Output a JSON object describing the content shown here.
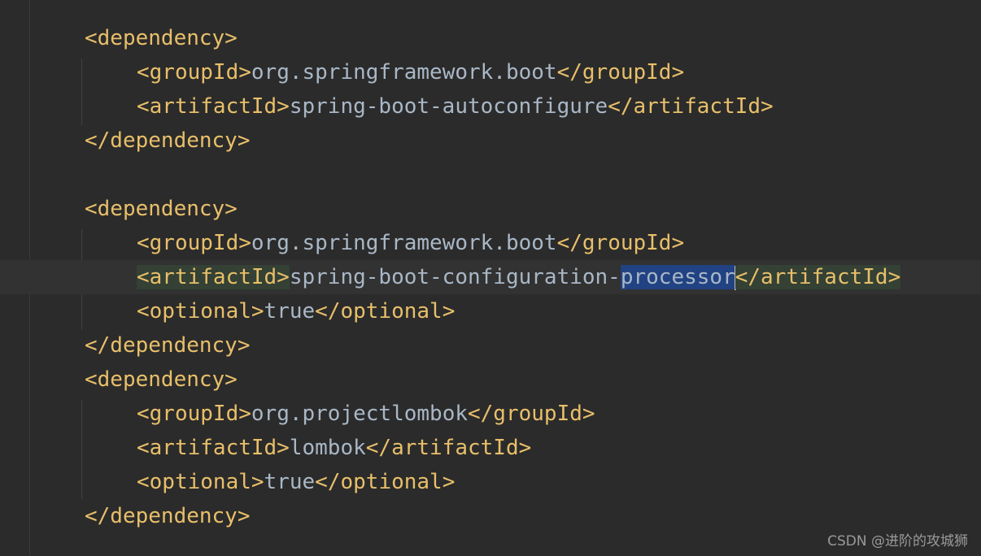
{
  "code": {
    "l1": [
      "<dependency>"
    ],
    "l2": [
      "<groupId>",
      "org.springframework.boot",
      "</groupId>"
    ],
    "l3": [
      "<artifactId>",
      "spring-boot-autoconfigure",
      "</artifactId>"
    ],
    "l4": [
      "</dependency>"
    ],
    "l6": [
      "<dependency>"
    ],
    "l7": [
      "<groupId>",
      "org.springframework.boot",
      "</groupId>"
    ],
    "l8": [
      "<artifactId>",
      "spring-boot-configuration-",
      "processor",
      "</artifactId>"
    ],
    "l9": [
      "<optional>",
      "true",
      "</optional>"
    ],
    "l10": [
      "</dependency>"
    ],
    "l11": [
      "<dependency>"
    ],
    "l12": [
      "<groupId>",
      "org.projectlombok",
      "</groupId>"
    ],
    "l13": [
      "<artifactId>",
      "lombok",
      "</artifactId>"
    ],
    "l14": [
      "<optional>",
      "true",
      "</optional>"
    ],
    "l15": [
      "</dependency>"
    ]
  },
  "watermark": "CSDN @进阶的攻城狮",
  "colors": {
    "background": "#2b2b2b",
    "tag": "#e8bf6a",
    "text": "#a9b7c6",
    "selection": "#214283",
    "tag_match_highlight": "#344134"
  }
}
